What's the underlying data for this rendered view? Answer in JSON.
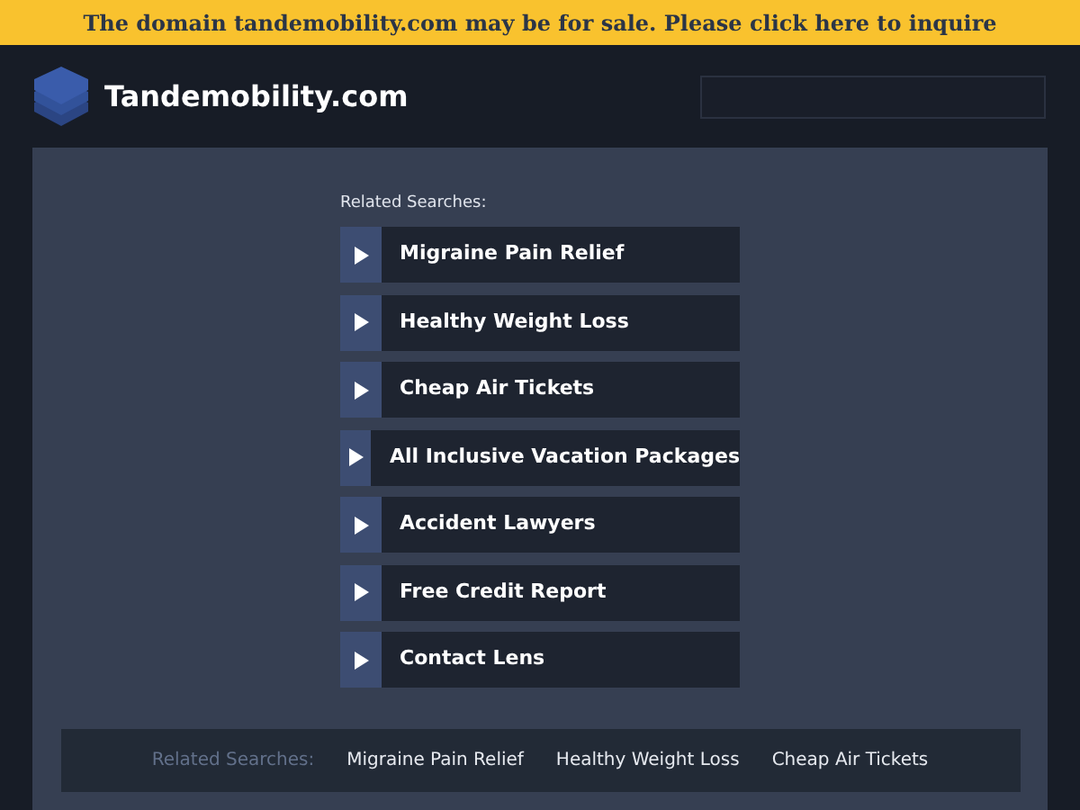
{
  "banner": {
    "text": "The domain tandemobility.com may be for sale. Please click here to inquire"
  },
  "header": {
    "site_name": "Tandemobility.com"
  },
  "related": {
    "label": "Related Searches:",
    "items": [
      "Migraine Pain Relief",
      "Healthy Weight Loss",
      "Cheap Air Tickets",
      "All Inclusive Vacation Packages",
      "Accident Lawyers",
      "Free Credit Report",
      "Contact Lens"
    ]
  },
  "footer": {
    "label": "Related Searches:",
    "links": [
      "Migraine Pain Relief",
      "Healthy Weight Loss",
      "Cheap Air Tickets"
    ]
  }
}
